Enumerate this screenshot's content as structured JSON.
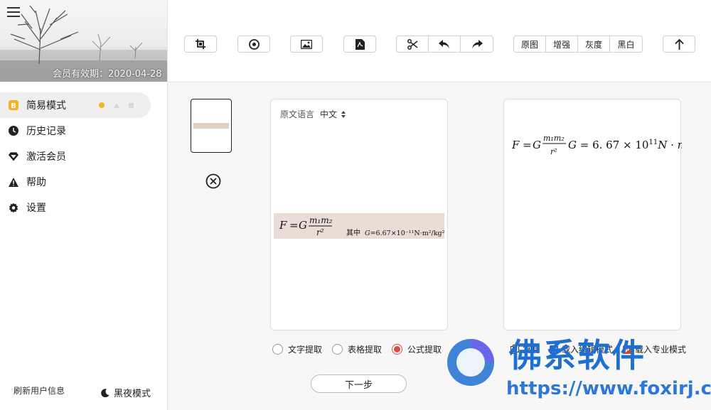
{
  "sidebar": {
    "expiry": "会员有效期：2020-04-28",
    "items": [
      {
        "label": "简易模式",
        "icon": "badge-b-icon",
        "active": true
      },
      {
        "label": "历史记录",
        "icon": "clock-icon"
      },
      {
        "label": "激活会员",
        "icon": "diamond-icon"
      },
      {
        "label": "帮助",
        "icon": "warning-icon"
      },
      {
        "label": "设置",
        "icon": "gear-icon"
      }
    ],
    "refresh": "刷新用户信息",
    "night": "黑夜模式"
  },
  "toolbar": {
    "image_modes": [
      "原图",
      "增强",
      "灰度",
      "黑白"
    ],
    "icons": [
      "crop-icon",
      "camera-icon",
      "image-icon",
      "pdf-icon",
      "cut-icon",
      "undo-icon",
      "redo-icon",
      "upload-icon"
    ]
  },
  "source_panel": {
    "lang_label": "原文语言",
    "lang_value": "中文"
  },
  "extract": {
    "options": [
      "文字提取",
      "表格提取",
      "公式提取"
    ],
    "selected": 2
  },
  "next_button": "下一步",
  "actions": [
    "复制",
    "载入编辑模式",
    "载入专业模式"
  ],
  "watermark": {
    "name": "佛系软件",
    "url": "https://www.foxirj.com"
  },
  "colors": {
    "accent": "#e04848",
    "dot": "#f5b324",
    "watermark": "#1f6fd1"
  }
}
